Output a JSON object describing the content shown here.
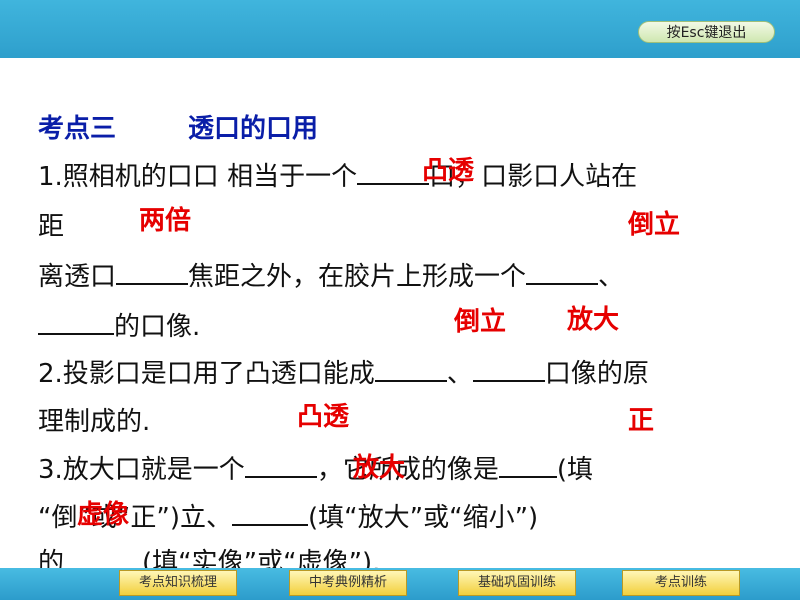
{
  "header": {
    "esc_label": "按Esc键退出"
  },
  "content": {
    "heading_num": "考点三",
    "heading_title": "透口的口用",
    "q1_a": "1.照相机的口口 相当于一个",
    "q1_b": "口，口影口人站在",
    "q1_c": "距",
    "q1_d": "离透口",
    "q1_e": "焦距之外，在胶片上形成一个",
    "q1_f": "、",
    "q1_g": "的口像.",
    "q2_a": "2.投影口是口用了凸透口能成",
    "q2_b": "、",
    "q2_c": "口像的原",
    "q2_d": "理制成的.",
    "q3_a": "3.放大口就是一个",
    "q3_b": "，它所成的像是",
    "q3_c": "(填",
    "q3_d": "“倒”或“正”)立、",
    "q3_e": "(填“放大”或“缩小”)",
    "q3_f": "的",
    "q3_g": "(填“实像”或“虚像”)."
  },
  "answers": {
    "a1": "凸透",
    "a2": "两倍",
    "a3": "倒立",
    "a4": "倒立",
    "a5": "放大",
    "a6": "凸透",
    "a7": "正",
    "a8": "放大",
    "a9": "虚像"
  },
  "nav": {
    "items": [
      "考点知识梳理",
      "中考典例精析",
      "基础巩固训练",
      "考点训练"
    ]
  },
  "colors": {
    "bar_blue": "#35a8d5",
    "heading_blue": "#0a1ea8",
    "answer_red": "#e60000",
    "nav_yellow": "#f2cf3c"
  }
}
